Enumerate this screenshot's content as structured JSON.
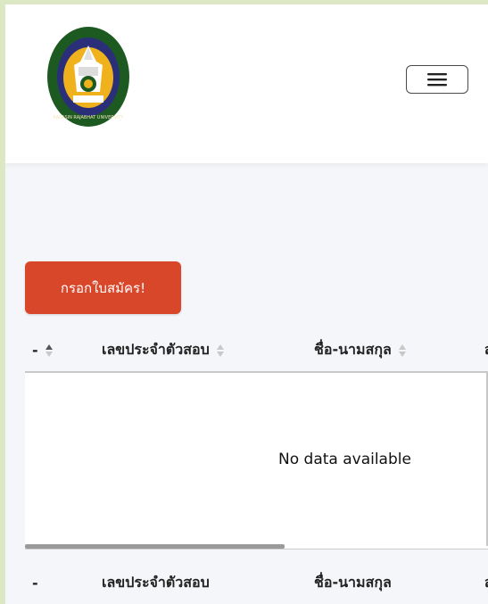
{
  "navbar": {
    "logo_alt": "university-seal",
    "logo_ring_text_bottom": "KALASIN RAJABHAT UNIVERSITY",
    "menu_icon": "hamburger-icon"
  },
  "apply_button": {
    "label": "กรอกใบสมัคร!"
  },
  "table": {
    "columns": [
      {
        "label": "-"
      },
      {
        "label": "เลขประจำตัวสอบ"
      },
      {
        "label": "ชื่อ-นามสกุล"
      },
      {
        "label": "ส"
      }
    ],
    "empty_message": "No data available"
  },
  "colors": {
    "page_background": "#dbe8c3",
    "content_background": "#f5f6f9",
    "apply_button": "#d9472a"
  }
}
